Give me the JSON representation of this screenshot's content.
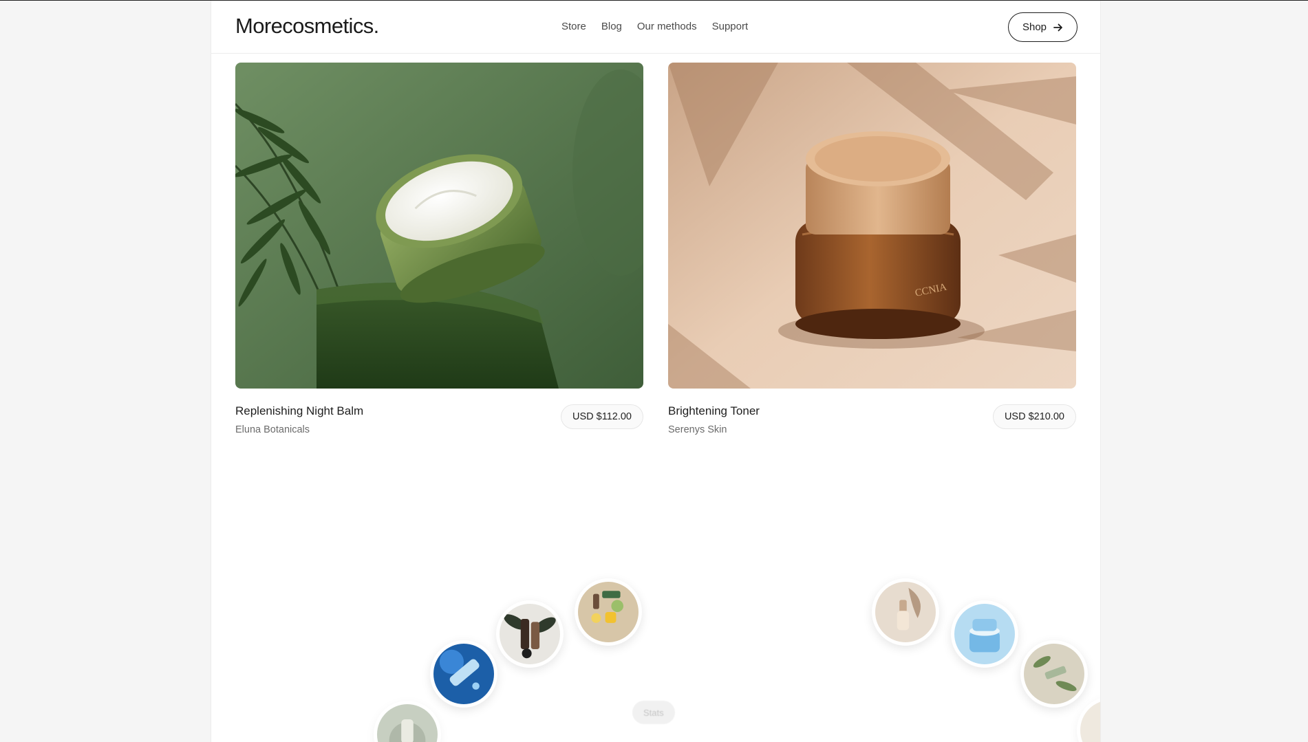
{
  "header": {
    "logo": "Morecosmetics.",
    "nav": [
      "Store",
      "Blog",
      "Our methods",
      "Support"
    ],
    "shop_label": "Shop"
  },
  "products": [
    {
      "title": "Replenishing Night Balm",
      "brand": "Eluna Botanicals",
      "price": "USD $112.00"
    },
    {
      "title": "Brightening Toner",
      "brand": "Serenys Skin",
      "price": "USD $210.00"
    }
  ],
  "product_image_text": "CCNIA",
  "showcase": {
    "stats_label": "Stats",
    "thumbnails": [
      "botanical-product-photo",
      "blue-tube-water-photo",
      "dark-bottles-leaves-photo",
      "green-tubes-sponges-photo",
      "foundation-dropper-photo",
      "blue-cream-jar-photo",
      "botanical-flatlay-photo",
      "cream-jar-photo"
    ]
  },
  "colors": {
    "accent": "#1b1b1b",
    "page_bg": "#f5f5f5",
    "card_bg": "#ffffff"
  }
}
